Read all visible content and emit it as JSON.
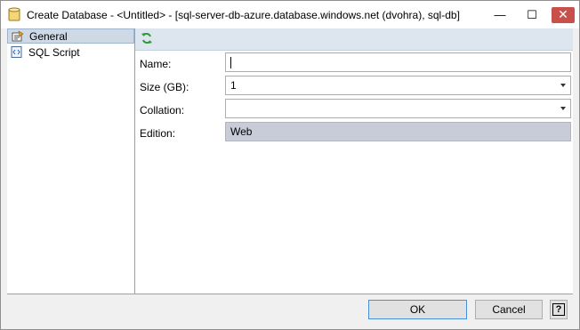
{
  "window": {
    "title": "Create Database - <Untitled> - [sql-server-db-azure.database.windows.net (dvohra), sql-db]",
    "minimize_glyph": "—",
    "maximize_glyph": "☐",
    "close_glyph": "✕"
  },
  "sidebar": {
    "items": [
      {
        "label": "General",
        "icon": "general-properties-icon",
        "selected": true
      },
      {
        "label": "SQL Script",
        "icon": "sql-script-icon",
        "selected": false
      }
    ]
  },
  "toolbar": {
    "refresh_icon": "refresh-icon"
  },
  "form": {
    "name": {
      "label": "Name:",
      "value": ""
    },
    "size": {
      "label": "Size (GB):",
      "value": "1"
    },
    "collation": {
      "label": "Collation:",
      "value": ""
    },
    "edition": {
      "label": "Edition:",
      "value": "Web"
    }
  },
  "buttons": {
    "ok": "OK",
    "cancel": "Cancel",
    "help": "?"
  },
  "colors": {
    "close_button": "#c7504a",
    "selected_item": "#cfd9e6",
    "toolbar_bg": "#dde5ee",
    "readonly_field": "#c8ccd8",
    "refresh_green": "#2e9a3a"
  }
}
